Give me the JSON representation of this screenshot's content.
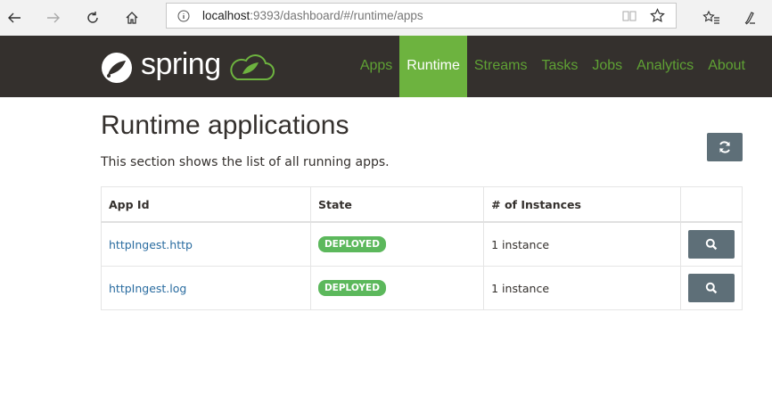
{
  "browser": {
    "url_host": "localhost",
    "url_rest": ":9393/dashboard/#/runtime/apps",
    "icons": [
      "back-arrow-icon",
      "forward-arrow-icon",
      "reload-icon",
      "home-icon",
      "info-icon",
      "reader-mode-icon",
      "favorite-star-icon",
      "favorites-list-icon",
      "pen-icon"
    ]
  },
  "header": {
    "logo_text": "spring",
    "menu": [
      {
        "label": "Apps",
        "active": false
      },
      {
        "label": "Runtime",
        "active": true
      },
      {
        "label": "Streams",
        "active": false
      },
      {
        "label": "Tasks",
        "active": false
      },
      {
        "label": "Jobs",
        "active": false
      },
      {
        "label": "Analytics",
        "active": false
      },
      {
        "label": "About",
        "active": false
      }
    ]
  },
  "main": {
    "title": "Runtime applications",
    "description": "This section shows the list of all running apps.",
    "refresh_icon": "refresh-icon",
    "table": {
      "headers": [
        "App Id",
        "State",
        "# of Instances",
        ""
      ],
      "rows": [
        {
          "app_id": "httpIngest.http",
          "state": "DEPLOYED",
          "instances": "1 instance",
          "action_icon": "search-icon"
        },
        {
          "app_id": "httpIngest.log",
          "state": "DEPLOYED",
          "instances": "1 instance",
          "action_icon": "search-icon"
        }
      ]
    }
  },
  "colors": {
    "header_bg": "#34302d",
    "menu_text": "#5fa134",
    "menu_active_bg": "#6db33f",
    "badge_green": "#5cb85c",
    "button_gray": "#5e6f78",
    "link_blue": "#2a6ca0"
  }
}
